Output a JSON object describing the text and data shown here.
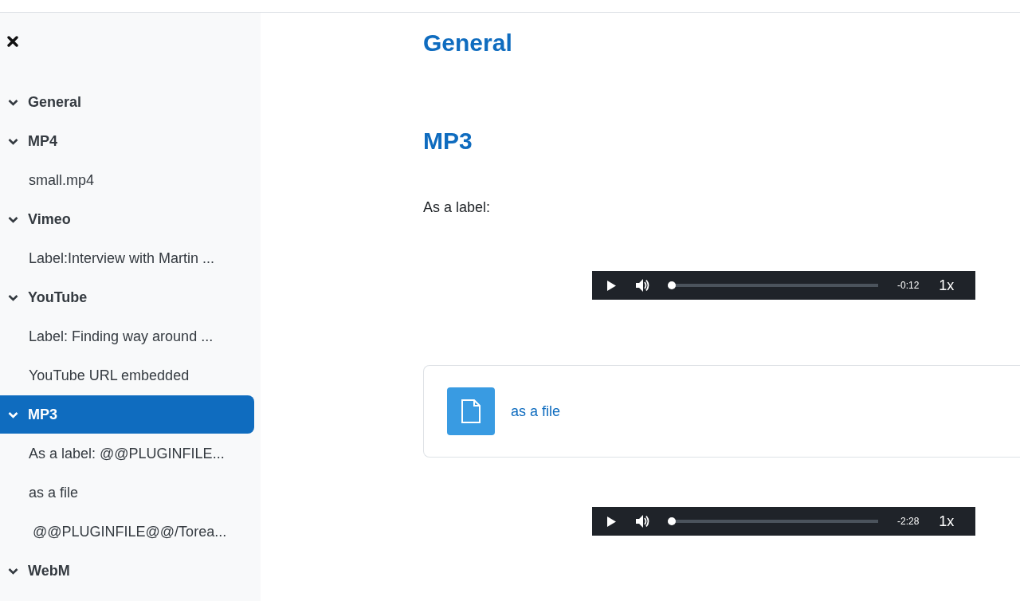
{
  "sidebar": {
    "sections": [
      {
        "title": "General",
        "expanded": true,
        "selected": false
      },
      {
        "title": "MP4",
        "expanded": true,
        "selected": false,
        "children": [
          {
            "label": "small.mp4"
          }
        ]
      },
      {
        "title": "Vimeo",
        "expanded": true,
        "selected": false,
        "children": [
          {
            "label": "Label:Interview with Martin ..."
          }
        ]
      },
      {
        "title": "YouTube",
        "expanded": true,
        "selected": false,
        "children": [
          {
            "label": "Label: Finding way around ..."
          },
          {
            "label": "YouTube URL embedded"
          }
        ]
      },
      {
        "title": "MP3",
        "expanded": true,
        "selected": true,
        "children": [
          {
            "label": "As a label: @@PLUGINFILE..."
          },
          {
            "label": "as a file"
          },
          {
            "label": " @@PLUGINFILE@@/Torea..."
          }
        ]
      },
      {
        "title": "WebM",
        "expanded": true,
        "selected": false
      }
    ]
  },
  "content": [
    {
      "kind": "heading",
      "text": "General"
    },
    {
      "kind": "heading",
      "text": "MP3"
    },
    {
      "kind": "text",
      "text": "As a label:"
    },
    {
      "kind": "player",
      "time": "-0:12",
      "speed": "1x",
      "level": 0
    },
    {
      "kind": "file",
      "text": "as a file"
    },
    {
      "kind": "player",
      "time": "-2:28",
      "speed": "1x",
      "level": 0
    }
  ]
}
